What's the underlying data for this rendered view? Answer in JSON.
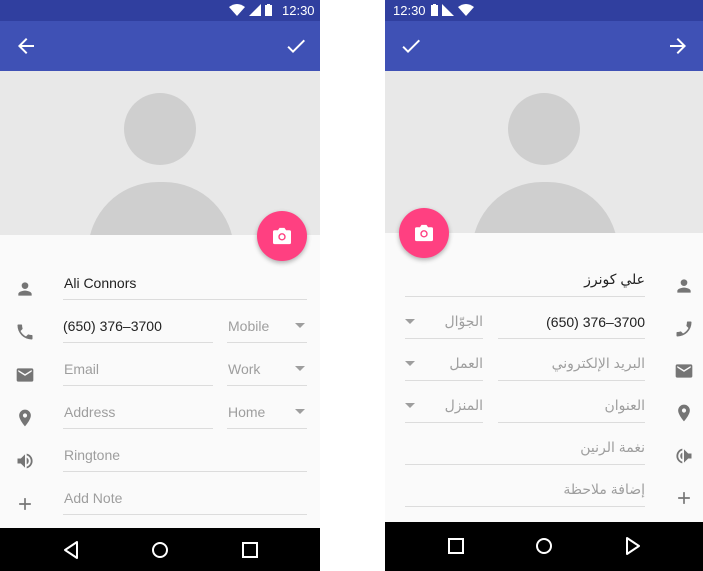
{
  "left": {
    "status_time": "12:30",
    "name": "Ali Connors",
    "phone": "(650) 376–3700",
    "phone_type": "Mobile",
    "email_placeholder": "Email",
    "email_type": "Work",
    "address_placeholder": "Address",
    "address_type": "Home",
    "ringtone_placeholder": "Ringtone",
    "note_placeholder": "Add Note"
  },
  "right": {
    "status_time": "12:30",
    "name": "علي كونرز",
    "phone": "(650) 376–3700",
    "phone_type": "الجوّال",
    "email_placeholder": "البريد الإلكتروني",
    "email_type": "العمل",
    "address_placeholder": "العنوان",
    "address_type": "المنزل",
    "ringtone_placeholder": "نغمة الرنين",
    "note_placeholder": "إضافة ملاحظة"
  },
  "icons": [
    "back-arrow-icon",
    "check-icon",
    "forward-arrow-icon",
    "camera-icon",
    "person-icon",
    "phone-icon",
    "email-icon",
    "location-icon",
    "volume-icon",
    "plus-icon",
    "nav-back-icon",
    "nav-home-icon",
    "nav-recents-icon",
    "wifi-icon",
    "signal-icon",
    "battery-icon"
  ],
  "colors": {
    "status_bar": "#303f9f",
    "app_bar": "#3f51b5",
    "fab": "#ff4081",
    "hero": "#e8e8e8"
  }
}
